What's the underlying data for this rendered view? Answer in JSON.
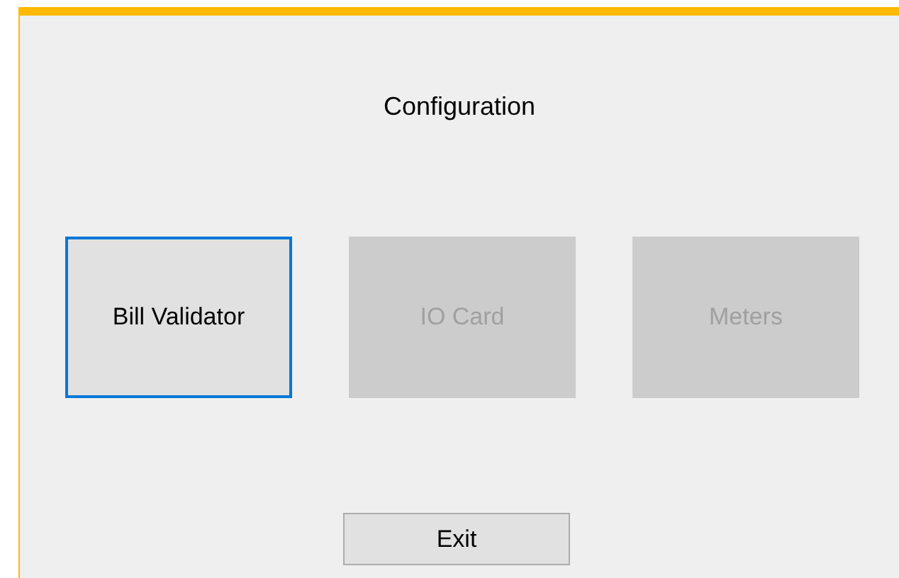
{
  "window": {
    "title": "Configuration"
  },
  "buttons": [
    {
      "label": "Bill Validator",
      "disabled": false,
      "focused": true
    },
    {
      "label": "IO Card",
      "disabled": true,
      "focused": false
    },
    {
      "label": "Meters",
      "disabled": true,
      "focused": false
    }
  ],
  "exit_button": {
    "label": "Exit"
  }
}
